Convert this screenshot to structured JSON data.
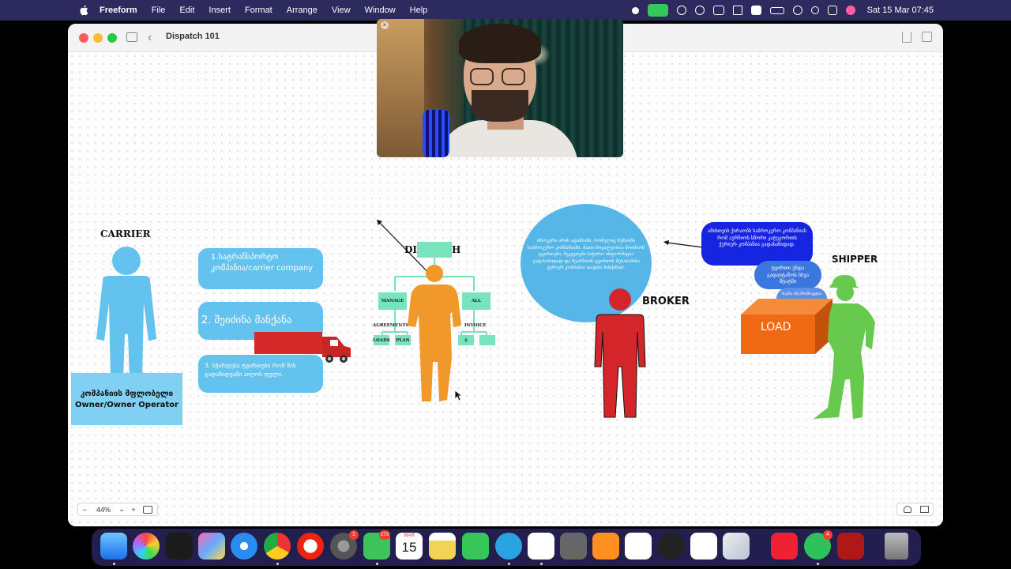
{
  "menubar": {
    "app_name": "Freeform",
    "items": [
      "File",
      "Edit",
      "Insert",
      "Format",
      "Arrange",
      "View",
      "Window",
      "Help"
    ],
    "clock": "Sat 15 Mar  07:45"
  },
  "window": {
    "title": "Dispatch 101"
  },
  "board": {
    "carrier": {
      "title": "CARRIER",
      "owner_label": "კომპანიის მფლობელი Owner/Owner Operator",
      "steps": [
        "1.სატრანსპორტო კომპანია/carrier company",
        "2.   შეიძინა მანქანა",
        "3.   სჭირდება ტვირთები რომ მის გადაზიდვაში აიღოს ფული."
      ]
    },
    "dispatch": {
      "title": "DISPATCH",
      "chart_labels": [
        "MANAGE",
        "ALL",
        "AGREEMENTS",
        "INVOICE",
        "LOADS",
        "PLAN",
        "$"
      ]
    },
    "broker": {
      "title": "BROKER",
      "description": "ბროკერი არის ადამიანი, რომელიც მუშაობს საბროკერო კომპანიაში. მათი მოვალეობაა მოიძიონ ტვირთები, შეკვეთები საჭირო ინფორმაცია გადასახიდად და შეარჩიონ ტვირთის შესაბამისი ქერიერ კომპანია თავისი მანქანით."
    },
    "shipper": {
      "title": "SHIPPER",
      "load_label": "LOAD",
      "bubbles": [
        "ამისთვის ქირაობს საბროკერო კომპანიას რომ აურჩიოს სწორი კატეგორიის ქერიერ კომპანია გადასაზიდად.",
        "ტვირთი უნდა გადაიტანოს სხვა შტატში",
        "მაგრა ამე მოიშოვეტია"
      ]
    }
  },
  "toolbar": {
    "zoom_minus": "−",
    "zoom_level": "44%",
    "zoom_chevron": "⌄",
    "zoom_plus": "+"
  },
  "dock": {
    "calendar_month": "MAR",
    "calendar_day": "15",
    "badges": {
      "system_settings": "1",
      "messages": "273",
      "whatsapp": "4"
    }
  },
  "colors": {
    "menubar": "#2d2a5e",
    "carrier_blue": "#64c2ee",
    "dispatch_orange": "#f0982a",
    "chart_green": "#78e4be",
    "broker_red": "#d4262a",
    "shipper_green": "#67c94d",
    "load_orange": "#ef6a12"
  }
}
